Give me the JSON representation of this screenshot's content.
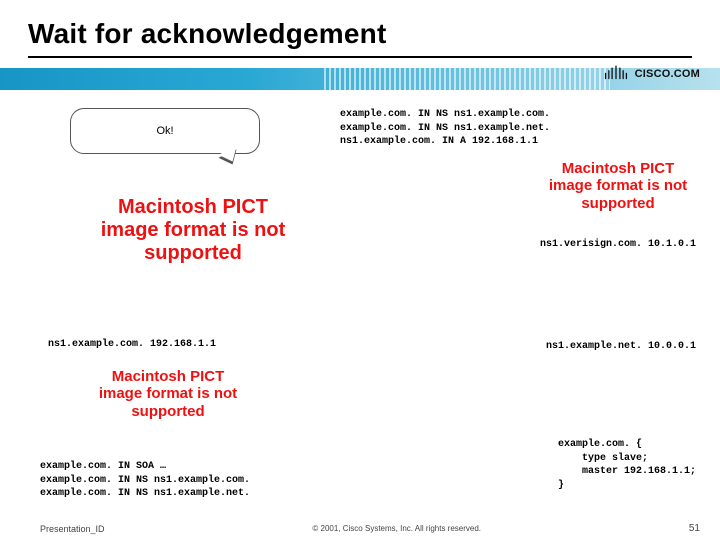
{
  "title": "Wait for acknowledgement",
  "logo_text": "CISCO.COM",
  "bubble_ok": "Ok!",
  "pict_text": "Macintosh PICT\nimage format\nis not supported",
  "top_right_block": "example.com. IN NS ns1.example.com.\nexample.com. IN NS ns1.example.net.\nns1.example.com. IN A 192.168.1.1",
  "right_line1": "ns1.verisign.com. 10.1.0.1",
  "left_mid_line": "ns1.example.com. 192.168.1.1",
  "right_line2": "ns1.example.net. 10.0.0.1",
  "left_code": "example.com. IN SOA …\nexample.com. IN NS ns1.example.com.\nexample.com. IN NS ns1.example.net.",
  "right_code": "example.com. {\n    type slave;\n    master 192.168.1.1;\n}",
  "footer": {
    "left": "Presentation_ID",
    "mid": "© 2001, Cisco Systems, Inc. All rights reserved.",
    "right": "51"
  }
}
